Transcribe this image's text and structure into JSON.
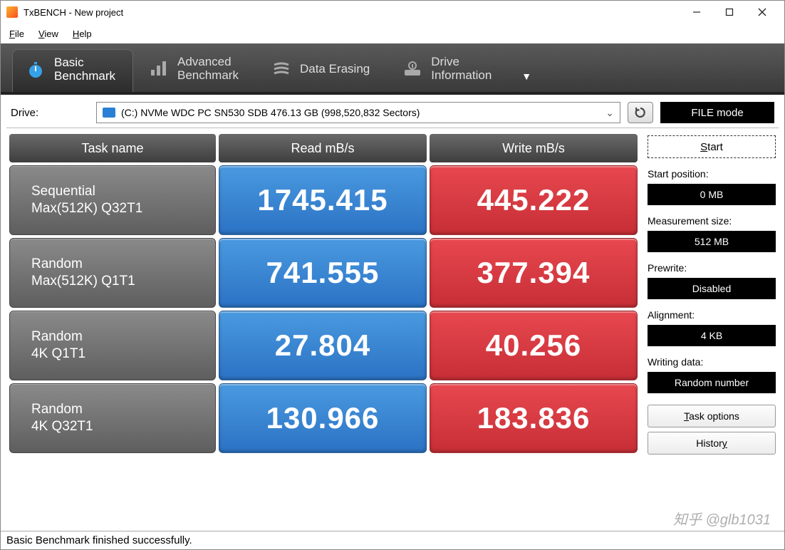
{
  "window": {
    "title": "TxBENCH - New project"
  },
  "menu": {
    "file": "File",
    "view": "View",
    "help": "Help"
  },
  "tabs": {
    "basic": {
      "line1": "Basic",
      "line2": "Benchmark"
    },
    "advanced": {
      "line1": "Advanced",
      "line2": "Benchmark"
    },
    "erase": {
      "label": "Data Erasing"
    },
    "drive": {
      "line1": "Drive",
      "line2": "Information"
    }
  },
  "drive": {
    "label": "Drive:",
    "selected": "(C:) NVMe WDC PC SN530 SDB  476.13 GB (998,520,832 Sectors)",
    "filemode": "FILE mode"
  },
  "headers": {
    "task": "Task name",
    "read": "Read mB/s",
    "write": "Write mB/s"
  },
  "rows": [
    {
      "t1": "Sequential",
      "t2": "Max(512K) Q32T1",
      "read": "1745.415",
      "write": "445.222"
    },
    {
      "t1": "Random",
      "t2": "Max(512K) Q1T1",
      "read": "741.555",
      "write": "377.394"
    },
    {
      "t1": "Random",
      "t2": "4K Q1T1",
      "read": "27.804",
      "write": "40.256"
    },
    {
      "t1": "Random",
      "t2": "4K Q32T1",
      "read": "130.966",
      "write": "183.836"
    }
  ],
  "side": {
    "start": "Start",
    "startpos_lbl": "Start position:",
    "startpos_val": "0 MB",
    "msize_lbl": "Measurement size:",
    "msize_val": "512 MB",
    "prewrite_lbl": "Prewrite:",
    "prewrite_val": "Disabled",
    "align_lbl": "Alignment:",
    "align_val": "4 KB",
    "wdata_lbl": "Writing data:",
    "wdata_val": "Random number",
    "taskopts": "Task options",
    "history": "History"
  },
  "status": "Basic Benchmark finished successfully.",
  "watermark": "知乎 @glb1031"
}
